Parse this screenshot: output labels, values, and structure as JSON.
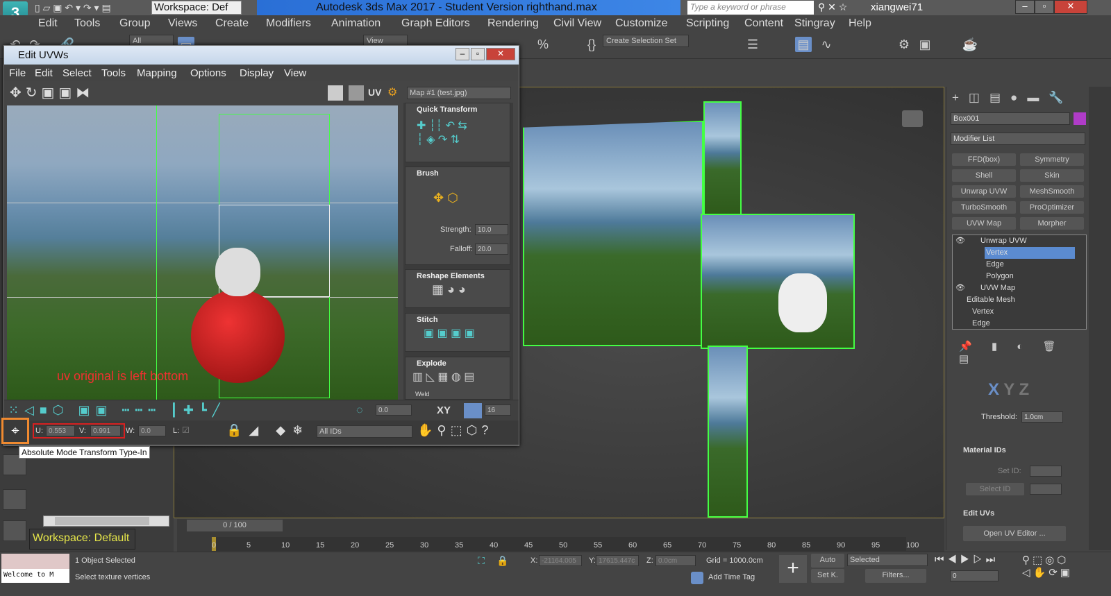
{
  "app": {
    "title": "Autodesk 3ds Max 2017 - Student Version    righthand.max",
    "logo": "3",
    "workspace": "Workspace: Def",
    "search_placeholder": "Type a keyword or phrase",
    "user": "xiangwei71"
  },
  "menu": [
    "Edit",
    "Tools",
    "Group",
    "Views",
    "Create",
    "Modifiers",
    "Animation",
    "Graph Editors",
    "Rendering",
    "Civil View",
    "Customize",
    "Scripting",
    "Content",
    "Stingray",
    "Help"
  ],
  "toolbar": {
    "filter": "All",
    "ref_coord": "View",
    "selection_set": "Create Selection Set"
  },
  "uvw": {
    "title": "Edit UVWs",
    "menu": [
      "File",
      "Edit",
      "Select",
      "Tools",
      "Mapping",
      "Options",
      "Display",
      "View"
    ],
    "uv_label": "UV",
    "map": "Map #1 (test.jpg)",
    "annotation": "uv original is left bottom",
    "panels": {
      "quick_transform": "Quick Transform",
      "brush": "Brush",
      "strength_label": "Strength:",
      "strength": "10.0",
      "falloff_label": "Falloff:",
      "falloff": "20.0",
      "reshape": "Reshape Elements",
      "stitch": "Stitch",
      "explode": "Explode",
      "weld": "Weld"
    },
    "bar1": {
      "angle": "0.0",
      "xy": "XY",
      "snap": "16"
    },
    "bar2": {
      "u_label": "U:",
      "u": "0.553",
      "v_label": "V:",
      "v": "0.991",
      "w_label": "W:",
      "w": "0.0",
      "l_label": "L:",
      "ids": "All IDs"
    },
    "tooltip": "Absolute Mode Transform Type-In"
  },
  "cmd": {
    "object": "Box001",
    "object_color": "#b03cc8",
    "modifier_list": "Modifier List",
    "modifiers": [
      "FFD(box)",
      "Symmetry",
      "Shell",
      "Skin",
      "Unwrap UVW",
      "MeshSmooth",
      "TurboSmooth",
      "ProOptimizer",
      "UVW Map",
      "Morpher"
    ],
    "stack": [
      "Unwrap UVW",
      "Vertex",
      "Edge",
      "Polygon",
      "UVW Map",
      "Editable Mesh",
      "Vertex",
      "Edge"
    ],
    "xyz": [
      "X",
      "Y",
      "Z"
    ],
    "threshold_label": "Threshold:",
    "threshold": "1.0cm",
    "material_ids": "Material IDs",
    "set_id": "Set ID:",
    "select_id": "Select ID",
    "edit_uvs": "Edit UVs",
    "open_uv_editor": "Open UV Editor ..."
  },
  "left": {
    "workspace": "Workspace: Default",
    "welcome": "Welcome to M"
  },
  "timeline": {
    "frame": "0 / 100",
    "ticks": [
      "0",
      "5",
      "10",
      "15",
      "20",
      "25",
      "30",
      "35",
      "40",
      "45",
      "50",
      "55",
      "60",
      "65",
      "70",
      "75",
      "80",
      "85",
      "90",
      "95",
      "100"
    ]
  },
  "status": {
    "selected": "1 Object Selected",
    "prompt": "Select texture vertices",
    "x_label": "X:",
    "x": "-21164.005",
    "y_label": "Y:",
    "y": "17615.447c",
    "z_label": "Z:",
    "z": "0.0cm",
    "grid": "Grid = 1000.0cm",
    "add_time_tag": "Add Time Tag",
    "auto": "Auto",
    "setk": "Set K.",
    "selected_dd": "Selected",
    "filters": "Filters...",
    "frame": "0"
  }
}
